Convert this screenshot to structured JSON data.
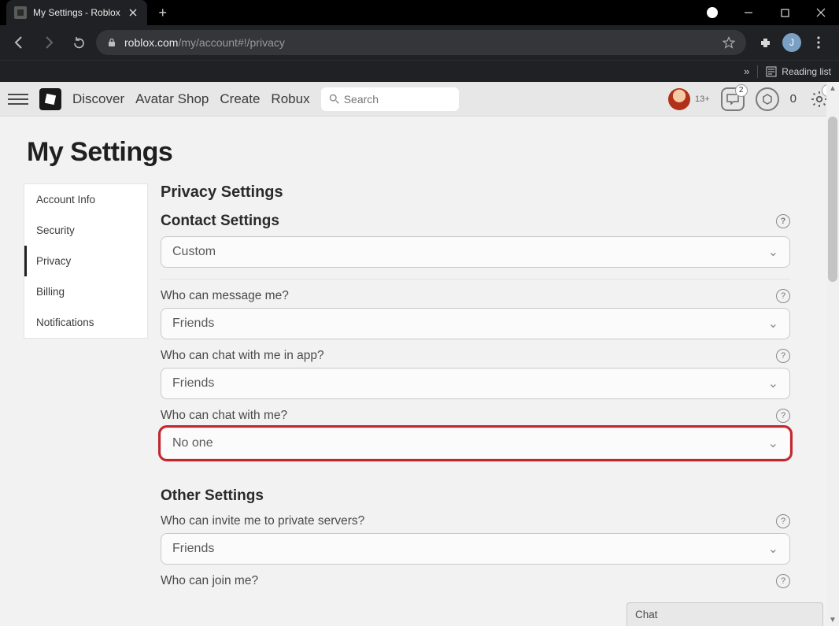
{
  "browser": {
    "tab_title": "My Settings - Roblox",
    "url_domain": "roblox.com",
    "url_path": "/my/account#!/privacy",
    "profile_initial": "J",
    "reading_list_label": "Reading list"
  },
  "site_nav": {
    "links": [
      "Discover",
      "Avatar Shop",
      "Create",
      "Robux"
    ],
    "search_placeholder": "Search",
    "age_badge": "13+",
    "notif_badge": "2",
    "settings_badge": "1",
    "robux_count": "0"
  },
  "page": {
    "title": "My Settings",
    "side_tabs": [
      "Account Info",
      "Security",
      "Privacy",
      "Billing",
      "Notifications"
    ],
    "active_tab_index": 2,
    "section_title": "Privacy Settings",
    "contact_section_title": "Contact Settings",
    "other_section_title": "Other Settings",
    "fields": {
      "contact_mode": {
        "value": "Custom"
      },
      "message": {
        "label": "Who can message me?",
        "value": "Friends"
      },
      "chat_app": {
        "label": "Who can chat with me in app?",
        "value": "Friends"
      },
      "chat": {
        "label": "Who can chat with me?",
        "value": "No one",
        "highlight": true
      },
      "private_servers": {
        "label": "Who can invite me to private servers?",
        "value": "Friends"
      },
      "join": {
        "label": "Who can join me?"
      }
    },
    "chat_dock_label": "Chat"
  }
}
